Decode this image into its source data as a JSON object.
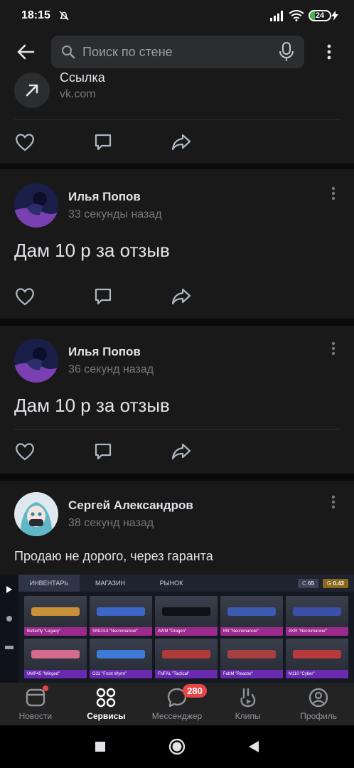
{
  "status_bar": {
    "time": "18:15",
    "battery": "24"
  },
  "appbar": {
    "search_placeholder": "Поиск по стене"
  },
  "link_card": {
    "title": "Ссылка",
    "url": "vk.com"
  },
  "posts": [
    {
      "author": "Илья Попов",
      "time": "33 секунды назад",
      "text": "Дам 10 р за отзыв"
    },
    {
      "author": "Илья Попов",
      "time": "36 секунд назад",
      "text": "Дам 10 р за отзыв"
    },
    {
      "author": "Сергей Александров",
      "time": "38 секунд назад",
      "text": "Продаю не дорого, через гаранта"
    }
  ],
  "game_shot": {
    "tabs": [
      "ИНВЕНТАРЬ",
      "МАГАЗИН",
      "РЫНОК"
    ],
    "currency_c": "65",
    "currency_g": "0.43",
    "items": [
      "Butterfly \"Legacy\"",
      "SM1014 \"Necromancer\"",
      "AWM \"Dragon\"",
      "M4 \"Necromancer\"",
      "AKR \"Necromancer\"",
      "UMP45 \"Winged\"",
      "G22 \"Frost Wyrm\"",
      "FNFAL \"Tactical\"",
      "FabM \"Reactor\"",
      "M110 \"Cyber\""
    ]
  },
  "bottom_nav": {
    "news": "Новости",
    "services": "Сервисы",
    "messenger": "Мессенджер",
    "messenger_badge": "280",
    "clips": "Клипы",
    "profile": "Профиль"
  },
  "colors": {
    "accent": "#ffffff",
    "badge": "#e64646",
    "card": "#19191a",
    "background": "#0a0a0a"
  }
}
